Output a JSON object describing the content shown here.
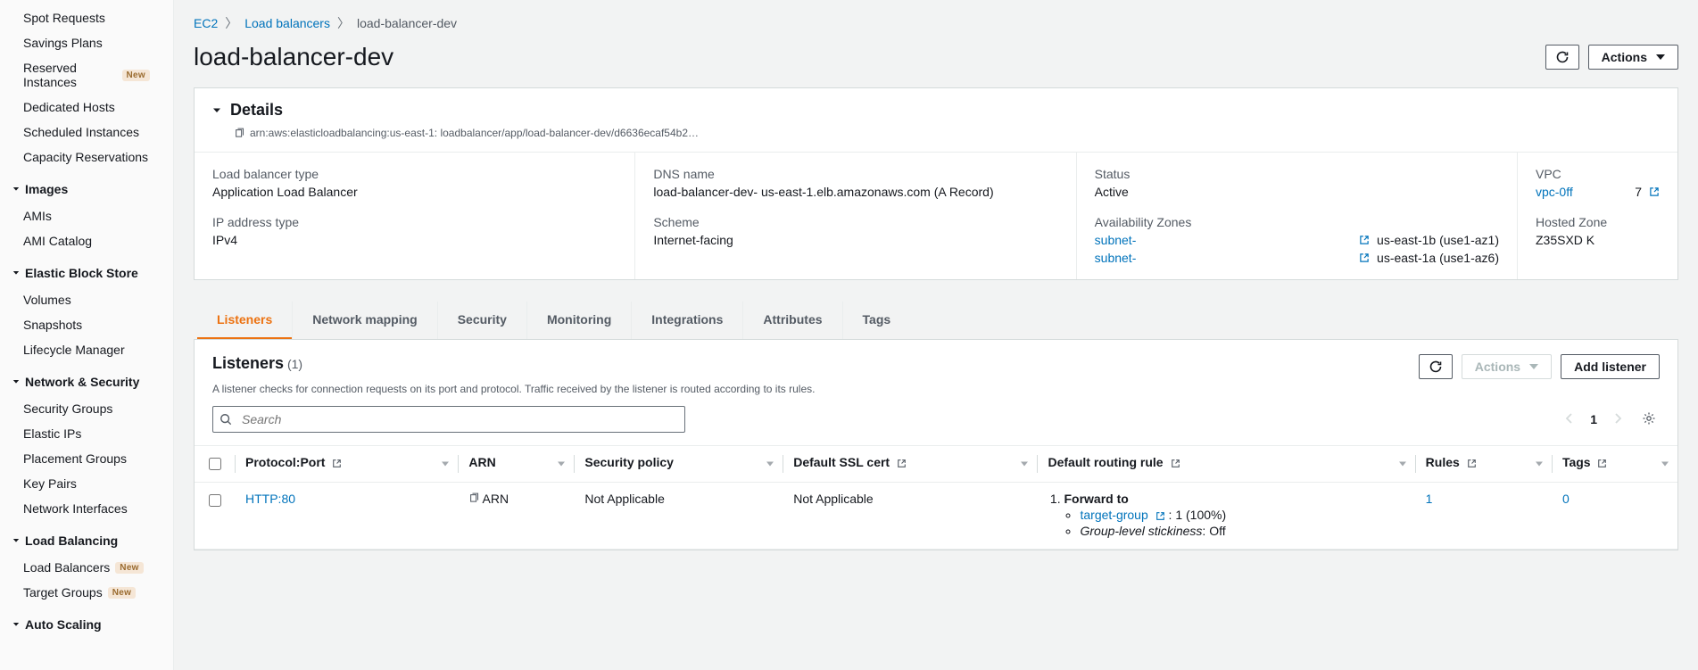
{
  "sidebar": {
    "groups": [
      {
        "items": [
          {
            "label": "Spot Requests",
            "badge": null
          },
          {
            "label": "Savings Plans",
            "badge": null
          },
          {
            "label": "Reserved Instances",
            "badge": "New"
          },
          {
            "label": "Dedicated Hosts",
            "badge": null
          },
          {
            "label": "Scheduled Instances",
            "badge": null
          },
          {
            "label": "Capacity Reservations",
            "badge": null
          }
        ]
      },
      {
        "heading": "Images",
        "items": [
          {
            "label": "AMIs",
            "badge": null
          },
          {
            "label": "AMI Catalog",
            "badge": null
          }
        ]
      },
      {
        "heading": "Elastic Block Store",
        "items": [
          {
            "label": "Volumes",
            "badge": null
          },
          {
            "label": "Snapshots",
            "badge": null
          },
          {
            "label": "Lifecycle Manager",
            "badge": null
          }
        ]
      },
      {
        "heading": "Network & Security",
        "items": [
          {
            "label": "Security Groups",
            "badge": null
          },
          {
            "label": "Elastic IPs",
            "badge": null
          },
          {
            "label": "Placement Groups",
            "badge": null
          },
          {
            "label": "Key Pairs",
            "badge": null
          },
          {
            "label": "Network Interfaces",
            "badge": null
          }
        ]
      },
      {
        "heading": "Load Balancing",
        "items": [
          {
            "label": "Load Balancers",
            "badge": "New"
          },
          {
            "label": "Target Groups",
            "badge": "New"
          }
        ]
      },
      {
        "heading": "Auto Scaling",
        "items": []
      }
    ]
  },
  "breadcrumb": {
    "root": "EC2",
    "parent": "Load balancers",
    "current": "load-balancer-dev"
  },
  "page": {
    "title": "load-balancer-dev",
    "actions_label": "Actions"
  },
  "details": {
    "heading": "Details",
    "arn": "arn:aws:elasticloadbalancing:us-east-1:            loadbalancer/app/load-balancer-dev/d6636ecaf54b2…",
    "lb_type": {
      "label": "Load balancer type",
      "value": "Application Load Balancer"
    },
    "ip_type": {
      "label": "IP address type",
      "value": "IPv4"
    },
    "dns": {
      "label": "DNS name",
      "value": "load-balancer-dev-                       us-east-1.elb.amazonaws.com (A Record)"
    },
    "scheme": {
      "label": "Scheme",
      "value": "Internet-facing"
    },
    "status": {
      "label": "Status",
      "value": "Active"
    },
    "az": {
      "label": "Availability Zones",
      "items": [
        {
          "subnet": "subnet-",
          "zone": "us-east-1b (use1-az1)"
        },
        {
          "subnet": "subnet-",
          "zone": "us-east-1a (use1-az6)"
        }
      ]
    },
    "vpc": {
      "label": "VPC",
      "value": "vpc-0ff",
      "suffix": "7"
    },
    "hz": {
      "label": "Hosted Zone",
      "value": "Z35SXD              K"
    }
  },
  "tabs": [
    {
      "label": "Listeners",
      "active": true
    },
    {
      "label": "Network mapping",
      "active": false
    },
    {
      "label": "Security",
      "active": false
    },
    {
      "label": "Monitoring",
      "active": false
    },
    {
      "label": "Integrations",
      "active": false
    },
    {
      "label": "Attributes",
      "active": false
    },
    {
      "label": "Tags",
      "active": false
    }
  ],
  "listeners": {
    "title": "Listeners",
    "count": "(1)",
    "desc": "A listener checks for connection requests on its port and protocol. Traffic received by the listener is routed according to its rules.",
    "actions_label": "Actions",
    "add_label": "Add listener",
    "search_placeholder": "Search",
    "page": "1",
    "columns": {
      "protocol": "Protocol:Port",
      "arn": "ARN",
      "sec": "Security policy",
      "ssl": "Default SSL cert",
      "rule": "Default routing rule",
      "rules": "Rules",
      "tags": "Tags"
    },
    "rows": [
      {
        "protocol_port": "HTTP:80",
        "arn": "ARN",
        "sec": "Not Applicable",
        "ssl": "Not Applicable",
        "rule_forward": "Forward to",
        "rule_target": "target-group",
        "rule_weight": ": 1 (100%)",
        "rule_stick_label": "Group-level stickiness",
        "rule_stick_val": ": Off",
        "rules": "1",
        "tags": "0"
      }
    ]
  }
}
